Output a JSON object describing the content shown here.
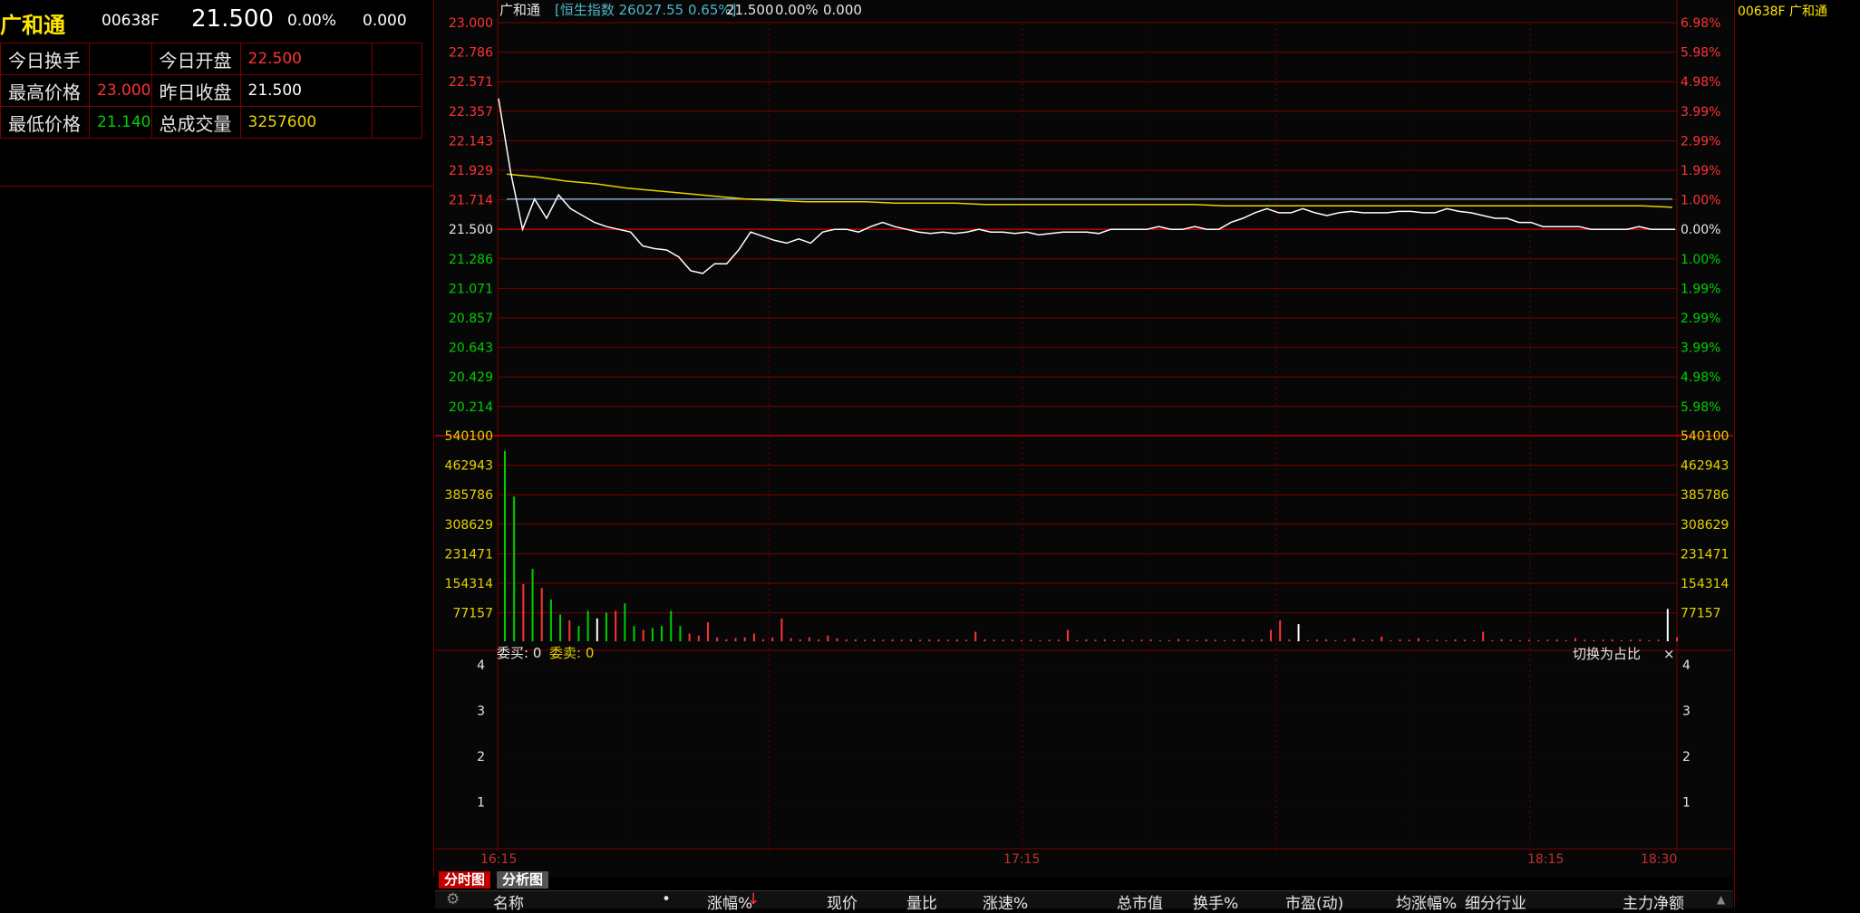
{
  "stock": {
    "name": "广和通",
    "code": "00638F",
    "price": "21.500",
    "change_pct": "0.00%",
    "change": "0.000"
  },
  "info": {
    "turnover_label": "今日换手",
    "turnover_value": "",
    "open_label": "今日开盘",
    "open_value": "22.500",
    "high_label": "最高价格",
    "high_value": "23.000",
    "prev_close_label": "昨日收盘",
    "prev_close_value": "21.500",
    "low_label": "最低价格",
    "low_value": "21.140",
    "volume_label": "总成交量",
    "volume_value": "3257600"
  },
  "chart_header": {
    "name": "广和通",
    "index_text": "[恒生指数 26027.55 0.65%]",
    "price": "21.500",
    "pct": "0.00%",
    "change": "0.000"
  },
  "order_panel": {
    "buy_label": "委买: 0",
    "sell_label": "委卖: 0",
    "switch_label": "切换为占比",
    "close_label": "×"
  },
  "right_panel": {
    "title": "00638F 广和通"
  },
  "tabs": {
    "fenshi": "分时图",
    "fenxi": "分析图"
  },
  "columns": {
    "name": "名称",
    "dot": "•",
    "change_pct": "涨幅%",
    "sort_arrow": "↓",
    "price": "现价",
    "vol_ratio": "量比",
    "speed": "涨速%",
    "mkt_cap": "总市值",
    "turnover": "换手%",
    "pe": "市盈(动)",
    "avg_chg": "均涨幅%",
    "industry": "细分行业",
    "main_flow": "主力净额"
  },
  "colors": {
    "up": "#ff3333",
    "down": "#00d000",
    "price_line": "#ffffff",
    "avg_line": "#e6d200",
    "index_line": "#5fa8c8",
    "grid": "#7a0000"
  },
  "chart_data": {
    "type": "line",
    "prev_close": 21.5,
    "price_axis_left": [
      "23.000",
      "22.786",
      "22.571",
      "22.357",
      "22.143",
      "21.929",
      "21.714",
      "21.500",
      "21.286",
      "21.071",
      "20.857",
      "20.643",
      "20.429",
      "20.214"
    ],
    "price_axis_right": [
      "6.98%",
      "5.98%",
      "4.98%",
      "3.99%",
      "2.99%",
      "1.99%",
      "1.00%",
      "0.00%",
      "1.00%",
      "1.99%",
      "2.99%",
      "3.99%",
      "4.98%",
      "5.98%"
    ],
    "volume_axis": [
      "540100",
      "462943",
      "385786",
      "308629",
      "231471",
      "154314",
      "77157"
    ],
    "order_axis": [
      "4",
      "3",
      "2",
      "1"
    ],
    "time_labels": [
      "16:15",
      "17:15",
      "18:15",
      "18:30"
    ],
    "ylim": [
      20.0,
      23.0
    ],
    "series": [
      {
        "values": [
          22.45,
          21.92,
          21.5,
          21.72,
          21.58,
          21.75,
          21.65,
          21.6,
          21.55,
          21.52,
          21.5,
          21.48,
          21.38,
          21.36,
          21.35,
          21.3,
          21.2,
          21.18,
          21.25,
          21.25,
          21.35,
          21.48,
          21.45,
          21.42,
          21.4,
          21.43,
          21.4,
          21.48,
          21.5,
          21.5,
          21.48,
          21.52,
          21.55,
          21.52,
          21.5,
          21.48,
          21.47,
          21.48,
          21.47,
          21.48,
          21.5,
          21.48,
          21.48,
          21.47,
          21.48,
          21.46,
          21.47,
          21.48,
          21.48,
          21.48,
          21.47,
          21.5,
          21.5,
          21.5,
          21.5,
          21.52,
          21.5,
          21.5,
          21.52,
          21.5,
          21.5,
          21.55,
          21.58,
          21.62,
          21.65,
          21.62,
          21.62,
          21.65,
          21.62,
          21.6,
          21.62,
          21.63,
          21.62,
          21.62,
          21.62,
          21.63,
          21.63,
          21.62,
          21.62,
          21.65,
          21.63,
          21.62,
          21.6,
          21.58,
          21.58,
          21.55,
          21.55,
          21.52,
          21.52,
          21.52,
          21.52,
          21.5,
          21.5,
          21.5,
          21.5,
          21.52,
          21.5,
          21.5,
          21.5
        ]
      },
      {
        "values": [
          21.9,
          21.88,
          21.85,
          21.83,
          21.8,
          21.78,
          21.76,
          21.74,
          21.72,
          21.71,
          21.7,
          21.7,
          21.7,
          21.69,
          21.69,
          21.69,
          21.68,
          21.68,
          21.68,
          21.68,
          21.68,
          21.68,
          21.68,
          21.68,
          21.67,
          21.67,
          21.67,
          21.67,
          21.67,
          21.67,
          21.67,
          21.67,
          21.67,
          21.67,
          21.67,
          21.67,
          21.67,
          21.67,
          21.67,
          21.66
        ]
      },
      {
        "values": [
          21.72,
          21.72,
          21.72,
          21.72,
          21.72,
          21.72,
          21.72,
          21.72,
          21.72,
          21.72
        ]
      }
    ],
    "volume": {
      "values": [
        500000,
        380000,
        150000,
        190000,
        140000,
        110000,
        70000,
        55000,
        40000,
        80000,
        60000,
        75000,
        80000,
        100000,
        40000,
        30000,
        35000,
        40000,
        80000,
        40000,
        20000,
        15000,
        50000,
        10000,
        5000,
        8000,
        10000,
        20000,
        5000,
        10000,
        60000,
        8000,
        5000,
        10000,
        5000,
        15000,
        8000,
        5000,
        5000,
        4000,
        5000,
        4000,
        5000,
        4000,
        5000,
        4000,
        5000,
        5000,
        4000,
        5000,
        4000,
        25000,
        5000,
        4000,
        4000,
        4000,
        3000,
        4000,
        3000,
        4000,
        4000,
        30000,
        3000,
        5000,
        4000,
        5000,
        3000,
        4000,
        3000,
        4000,
        5000,
        3000,
        3000,
        6000,
        4000,
        3000,
        5000,
        4000,
        3000,
        4000,
        5000,
        3000,
        5000,
        30000,
        55000,
        5000,
        45000,
        3000,
        4000,
        5000,
        3000,
        4000,
        8000,
        3000,
        4000,
        12000,
        3000,
        5000,
        4000,
        8000,
        3000,
        4000,
        3000,
        5000,
        4000,
        3000,
        25000,
        3000,
        5000,
        4000,
        3000,
        4000,
        3000,
        4000,
        5000,
        3000,
        8000,
        4000,
        3000,
        4000,
        5000,
        3000,
        4000,
        5000,
        3000,
        4000,
        85000,
        10000
      ],
      "colors": [
        "green",
        "green",
        "red",
        "green",
        "red",
        "green",
        "green",
        "red",
        "green",
        "green",
        "white",
        "green",
        "red",
        "green",
        "green",
        "red",
        "green",
        "green",
        "green",
        "green",
        "red",
        "red",
        "red",
        "red",
        "red",
        "red",
        "red",
        "red",
        "red",
        "red",
        "red",
        "red",
        "red",
        "red",
        "red",
        "red",
        "red",
        "red",
        "red",
        "red",
        "red",
        "red",
        "red",
        "red",
        "red",
        "red",
        "red",
        "red",
        "red",
        "red",
        "red",
        "red",
        "red",
        "red",
        "red",
        "red",
        "red",
        "red",
        "red",
        "red",
        "red",
        "red",
        "red",
        "red",
        "red",
        "red",
        "red",
        "red",
        "red",
        "red",
        "red",
        "red",
        "red",
        "red",
        "red",
        "red",
        "red",
        "red",
        "red",
        "red",
        "red",
        "red",
        "red",
        "red",
        "red",
        "red",
        "white",
        "red",
        "red",
        "red",
        "red",
        "red",
        "red",
        "red",
        "red",
        "red",
        "red",
        "red",
        "red",
        "red",
        "red",
        "red",
        "red",
        "red",
        "red",
        "red",
        "red",
        "red",
        "red",
        "red",
        "red",
        "red",
        "red",
        "red",
        "red",
        "red",
        "red",
        "red",
        "red",
        "red",
        "red",
        "red",
        "red",
        "red",
        "red",
        "red",
        "white",
        "red"
      ]
    }
  }
}
